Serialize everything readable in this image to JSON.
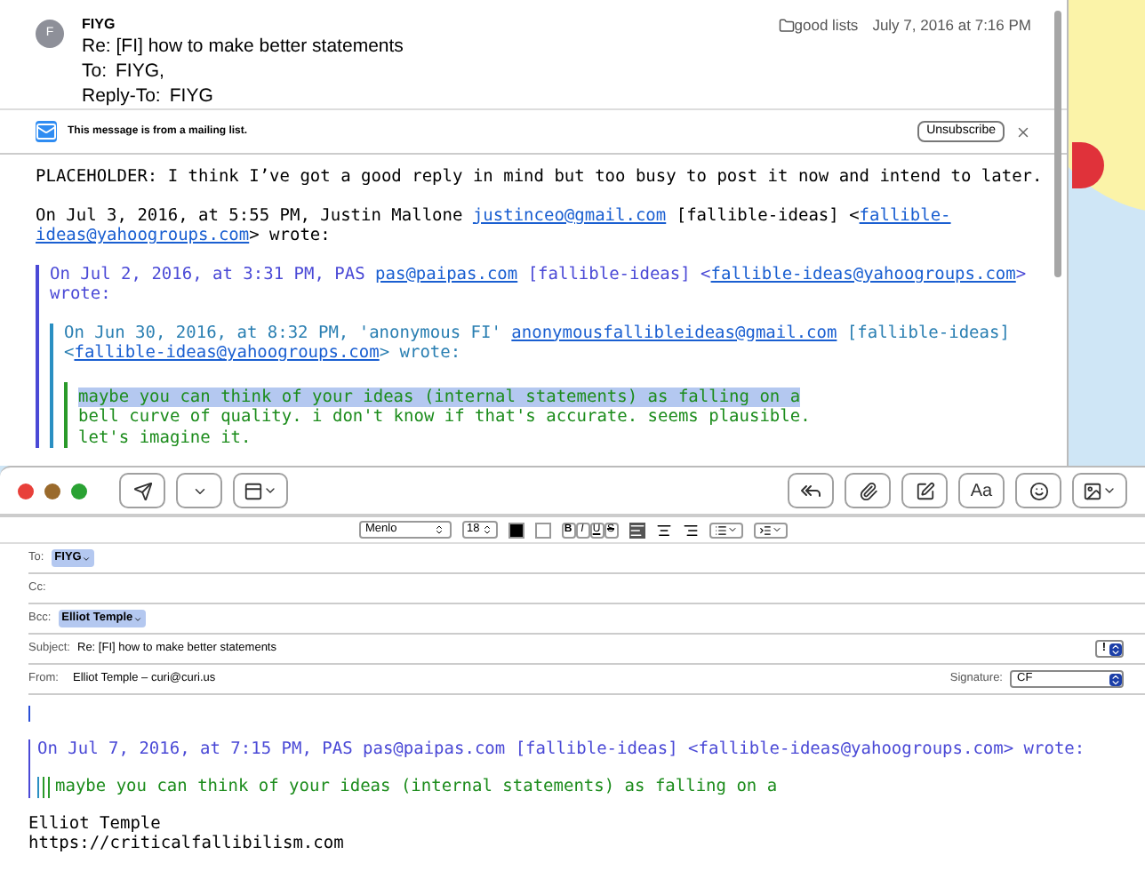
{
  "message": {
    "avatar": "F",
    "sender": "FIYG",
    "subject": "Re: [FI] how to make better statements",
    "to_label": "To:",
    "to": "FIYG,",
    "reply_to_label": "Reply-To:",
    "reply_to": "FIYG",
    "mailbox": "good lists",
    "date": "July 7, 2016 at 7:16 PM"
  },
  "mailing_list_banner": {
    "text": "This message is from a mailing list.",
    "button": "Unsubscribe"
  },
  "message_body": {
    "paragraph": "PLACEHOLDER: I think I’ve got a good reply in mind but too busy to post it now and intend to later.",
    "attribution": [
      [
        {
          "kind": "text",
          "text": "On Jul 3, 2016, at 5:55 PM, Justin Mallone "
        },
        {
          "kind": "link",
          "text": "justinceo@gmail.com"
        },
        {
          "kind": "text",
          "text": " [fallible-ideas] <"
        },
        {
          "kind": "link",
          "text": "fallible-"
        }
      ],
      [
        {
          "kind": "link",
          "text": "ideas@yahoogroups.com"
        },
        {
          "kind": "text",
          "text": "> wrote:"
        }
      ]
    ],
    "quote": {
      "attribution": [
        [
          {
            "kind": "text",
            "text": "On Jul 2, 2016, at 3:31 PM, PAS "
          },
          {
            "kind": "link",
            "text": "pas@paipas.com"
          },
          {
            "kind": "text",
            "text": " [fallible-ideas] <"
          },
          {
            "kind": "link",
            "text": "fallible-ideas@yahoogroups.com"
          },
          {
            "kind": "text",
            "text": ">"
          }
        ],
        [
          {
            "kind": "text",
            "text": "wrote:"
          }
        ]
      ],
      "quote": {
        "attribution": [
          [
            {
              "kind": "text",
              "text": "On Jun 30, 2016, at 8:32 PM, 'anonymous FI' "
            },
            {
              "kind": "link",
              "text": "anonymousfallibleideas@gmail.com"
            },
            {
              "kind": "text",
              "text": " [fallible-ideas]"
            }
          ],
          [
            {
              "kind": "text",
              "text": "<"
            },
            {
              "kind": "link",
              "text": "fallible-ideas@yahoogroups.com"
            },
            {
              "kind": "text",
              "text": "> wrote:"
            }
          ]
        ],
        "quote": {
          "lines": [
            {
              "text": "maybe you can think of your ideas (internal statements) as falling on a",
              "selected": true
            },
            {
              "text": "bell curve of quality. i don't know if that's accurate. seems plausible.",
              "selected": false
            },
            {
              "text": "let's imagine it.",
              "selected": false
            }
          ]
        }
      }
    }
  },
  "compose": {
    "format_bar": {
      "font": "Menlo",
      "size": "18",
      "styles": [
        "B",
        "I",
        "U",
        "S"
      ]
    },
    "font_button": "Aa",
    "fields": [
      {
        "kind": "recipients",
        "label": "To:",
        "tokens": [
          "FIYG"
        ]
      },
      {
        "kind": "recipients",
        "label": "Cc:"
      },
      {
        "kind": "recipients",
        "label": "Bcc:",
        "tokens": [
          "Elliot Temple"
        ]
      },
      {
        "kind": "subject",
        "label": "Subject:",
        "value": "Re: [FI] how to make better statements",
        "priority": "!"
      },
      {
        "kind": "from",
        "label": "From:",
        "value": "Elliot Temple – curi@curi.us",
        "signature_label": "Signature:",
        "signature": "CF"
      }
    ],
    "body": {
      "quote_attribution": "On Jul 7, 2016, at 7:15 PM, PAS pas@paipas.com [fallible-ideas] <fallible-ideas@yahoogroups.com> wrote:",
      "quoted_line": "maybe you can think of your ideas (internal statements) as falling on a",
      "signature": [
        "Elliot Temple",
        "https://criticalfallibilism.com"
      ]
    }
  }
}
